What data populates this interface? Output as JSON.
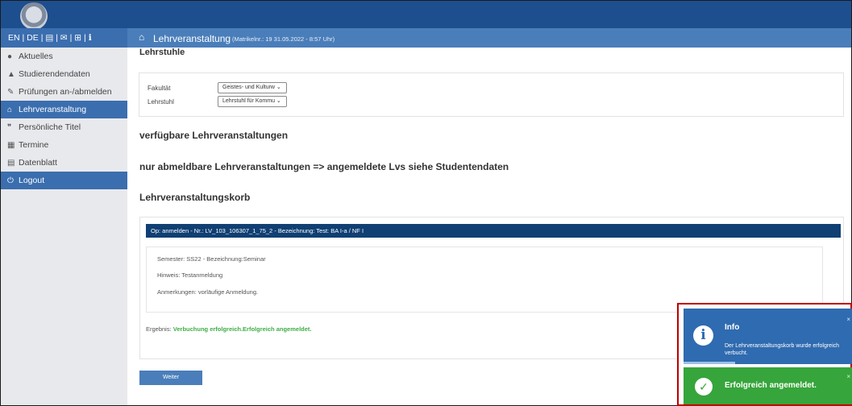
{
  "sidebar": {
    "lang_bar": {
      "en": "EN",
      "de": "DE",
      "separator": "|",
      "icons": [
        "book-icon",
        "mail-icon",
        "sitemap-icon",
        "info-icon"
      ]
    },
    "items": [
      {
        "label": "Aktuelles",
        "icon": "comment-icon",
        "active": false
      },
      {
        "label": "Studierendendaten",
        "icon": "graduation-cap-icon",
        "active": false
      },
      {
        "label": "Prüfungen an-/abmelden",
        "icon": "edit-icon",
        "active": false
      },
      {
        "label": "Lehrveranstaltung",
        "icon": "institution-icon",
        "active": true
      },
      {
        "label": "Persönliche Titel",
        "icon": "quote-icon",
        "active": false
      },
      {
        "label": "Termine",
        "icon": "calendar-icon",
        "active": false
      },
      {
        "label": "Datenblatt",
        "icon": "datasheet-icon",
        "active": false
      },
      {
        "label": "Logout",
        "icon": "power-icon",
        "active": false
      }
    ]
  },
  "header": {
    "title": "Lehrveranstaltung",
    "meta": "(Matrikelnr.: 19        31.05.2022 - 8:57 Uhr)"
  },
  "main": {
    "cut_title": "Lehrstuhle",
    "filters": {
      "fakultaet_label": "Fakultät",
      "fakultaet_value": "Geistes- und Kulturw ⌄",
      "lehrstuhl_label": "Lehrstuhl",
      "lehrstuhl_value": "Lehrstuhl für Kommu ⌄"
    },
    "heading_available": "verfügbare Lehrveranstaltungen",
    "heading_abmeldbar": "nur abmeldbare Lehrveranstaltungen => angemeldete Lvs siehe Studentendaten",
    "heading_korb": "Lehrveranstaltungskorb",
    "korb": {
      "op_line": "Op: anmelden - Nr.: LV_103_106307_1_75_2 - Bezeichnung: Test: BA I-a / NF I",
      "semester": "Semester: SS22 - Bezeichnung:Seminar",
      "hinweis": "Hinweis: Testanmeldung",
      "anmerkungen": "Anmerkungen: vorläufige Anmeldung.",
      "ergebnis_label": "Ergebnis:",
      "ergebnis_value": "Verbuchung erfolgreich.Erfolgreich angemeldet."
    },
    "weiter_button": "Weiter"
  },
  "toasts": {
    "info": {
      "title": "Info",
      "message": "Der Lehrveranstaltungskorb wurde erfolgreich verbucht.",
      "close": "×",
      "color": "#2f6bb0"
    },
    "success": {
      "title": "Erfolgreich angemeldet.",
      "close": "×",
      "color": "#36a53b"
    }
  }
}
